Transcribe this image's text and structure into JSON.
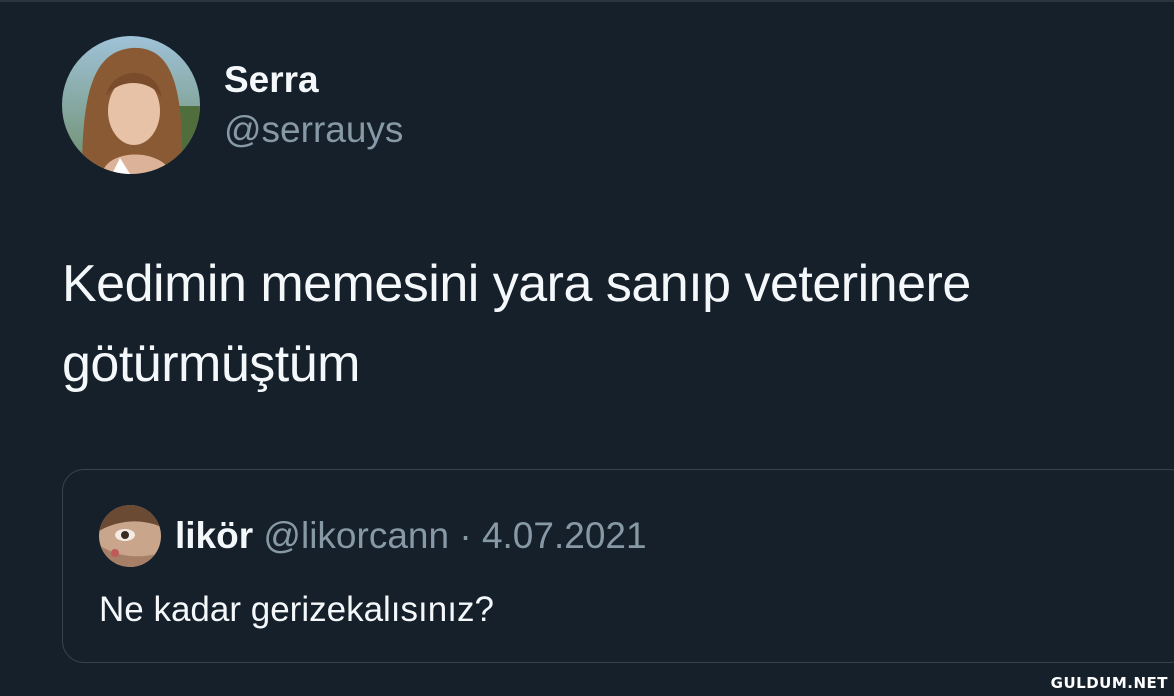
{
  "tweet": {
    "author_name": "Serra",
    "author_handle": "@serrauys",
    "avatar_icon": "profile-photo",
    "text": "Kedimin memesini yara sanıp veterinere götürmüştüm"
  },
  "quoted_tweet": {
    "author_name": "likör",
    "author_handle": "@likorcann",
    "separator": "·",
    "date": "4.07.2021",
    "avatar_icon": "profile-photo",
    "text": "Ne kadar gerizekalısınız?"
  },
  "watermark": "GULDUM.NET",
  "colors": {
    "background": "#15202b",
    "primary_text": "#f5f8fa",
    "secondary_text": "#8899a6",
    "border": "#38444d"
  }
}
